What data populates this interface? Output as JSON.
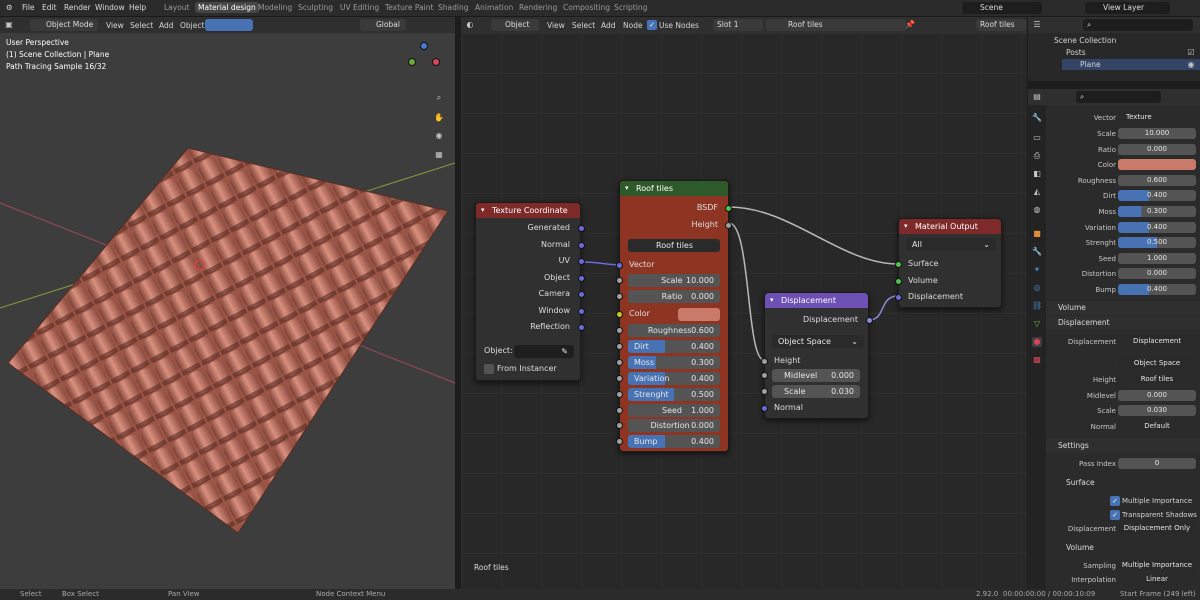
{
  "top_menu": {
    "file": "File",
    "edit": "Edit",
    "render": "Render",
    "window": "Window",
    "help": "Help"
  },
  "workspaces": [
    "Layout",
    "Material design",
    "Modeling",
    "Sculpting",
    "UV Editing",
    "Texture Paint",
    "Shading",
    "Animation",
    "Rendering",
    "Compositing",
    "Scripting"
  ],
  "scene_name": "Scene",
  "view_layer": "View Layer",
  "viewport_header": {
    "mode": "Object Mode",
    "view": "View",
    "select": "Select",
    "add": "Add",
    "object": "Object",
    "orientation": "Global"
  },
  "viewport_overlay": {
    "line1": "User Perspective",
    "line2": "(1) Scene Collection | Plane",
    "line3": "Path Tracing Sample 16/32"
  },
  "node_header": {
    "type": "Object",
    "view": "View",
    "select": "Select",
    "add": "Add",
    "node": "Node",
    "use_nodes": "Use Nodes",
    "slot": "Slot 1",
    "material": "Roof tiles",
    "pin_material": "Roof tiles"
  },
  "node_editor_label": "Roof tiles",
  "nodes": {
    "texcoord": {
      "title": "Texture Coordinate",
      "outputs": [
        "Generated",
        "Normal",
        "UV",
        "Object",
        "Camera",
        "Window",
        "Reflection"
      ],
      "object_label": "Object:",
      "from_instancer": "From Instancer"
    },
    "rooftiles": {
      "title": "Roof tiles",
      "out_bsdf": "BSDF",
      "out_height": "Height",
      "group_name": "Roof tiles",
      "in_vector": "Vector",
      "in_color": "Color",
      "params": [
        {
          "label": "Scale",
          "value": "10.000",
          "fill": 0
        },
        {
          "label": "Ratio",
          "value": "0.000",
          "fill": 0
        },
        {
          "label": "Roughness",
          "value": "0.600",
          "fill": 0
        },
        {
          "label": "Dirt",
          "value": "0.400",
          "fill": 0.4
        },
        {
          "label": "Moss",
          "value": "0.300",
          "fill": 0.3
        },
        {
          "label": "Variation",
          "value": "0.400",
          "fill": 0.4
        },
        {
          "label": "Strenght",
          "value": "0.500",
          "fill": 0.5
        },
        {
          "label": "Seed",
          "value": "1.000",
          "fill": 0
        },
        {
          "label": "Distortion",
          "value": "0.000",
          "fill": 0
        },
        {
          "label": "Bump",
          "value": "0.400",
          "fill": 0.4
        }
      ]
    },
    "displacement": {
      "title": "Displacement",
      "out": "Displacement",
      "space": "Object Space",
      "height": "Height",
      "midlevel_label": "Midlevel",
      "midlevel": "0.000",
      "scale_label": "Scale",
      "scale": "0.030",
      "normal": "Normal"
    },
    "output": {
      "title": "Material Output",
      "target": "All",
      "surface": "Surface",
      "volume": "Volume",
      "displacement": "Displacement"
    }
  },
  "outliner": {
    "root": "Scene Collection",
    "collection": "Posts",
    "object": "Plane"
  },
  "properties": {
    "vector_label": "Vector",
    "vector_value": "Texture Coordinate...",
    "params": [
      {
        "label": "Scale",
        "value": "10.000",
        "fill": 0
      },
      {
        "label": "Ratio",
        "value": "0.000",
        "fill": 0
      },
      {
        "label": "Color",
        "value": "",
        "fill": 0
      },
      {
        "label": "Roughness",
        "value": "0.600",
        "fill": 0
      },
      {
        "label": "Dirt",
        "value": "0.400",
        "fill": 0.4
      },
      {
        "label": "Moss",
        "value": "0.300",
        "fill": 0.3
      },
      {
        "label": "Variation",
        "value": "0.400",
        "fill": 0.4
      },
      {
        "label": "Strenght",
        "value": "0.500",
        "fill": 0.5
      },
      {
        "label": "Seed",
        "value": "1.000",
        "fill": 0
      },
      {
        "label": "Distortion",
        "value": "0.000",
        "fill": 0
      },
      {
        "label": "Bump",
        "value": "0.400",
        "fill": 0.4
      }
    ],
    "volume_section": "Volume",
    "displacement_section": "Displacement",
    "disp_label": "Displacement",
    "disp_value": "Displacement",
    "disp_space": "Object Space",
    "height_label": "Height",
    "height_value": "Roof tiles",
    "midlevel_label": "Midlevel",
    "midlevel_value": "0.000",
    "scale_label": "Scale",
    "scale_value": "0.030",
    "normal_label": "Normal",
    "normal_value": "Default",
    "settings_section": "Settings",
    "pass_index_label": "Pass Index",
    "pass_index_value": "0",
    "surface_section": "Surface",
    "multiple_importance": "Multiple Importance",
    "transparent_shadows": "Transparent Shadows",
    "displacement_method_label": "Displacement",
    "displacement_method": "Displacement Only",
    "volume_sub": "Volume",
    "sampling_label": "Sampling",
    "sampling_value": "Multiple Importance",
    "interpolation_label": "Interpolation",
    "interpolation_value": "Linear"
  },
  "status": {
    "select": "Select",
    "box_select": "Box Select",
    "pan_view": "Pan View",
    "context_menu": "Node Context Menu",
    "version": "2.92.0",
    "time": "00:00:00:00 / 00:00:10:09",
    "start_frame": "Start Frame (249 left)"
  },
  "colors": {
    "accent": "#4772b3",
    "header_red": "#7f2a2a",
    "tile_color": "#c97a69",
    "disp_purple": "#6e4fb3",
    "node_body_red": "#8e3423"
  }
}
